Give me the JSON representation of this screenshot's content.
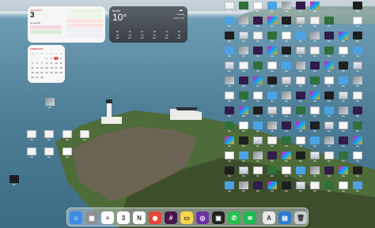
{
  "reminders": {
    "weekday": "SATURDAY",
    "day": "3",
    "left_items": [
      "no events",
      "",
      "",
      ""
    ],
    "right_items": [
      "Reminder item",
      "Reminder item",
      "Reminder item",
      "Reminder item",
      "Reminder item",
      "Reminder item"
    ]
  },
  "weather": {
    "city": "Berlin",
    "temp": "10°",
    "condition": "Cloudy",
    "hilo": "H:13° L:5°",
    "forecast": [
      {
        "t": "10",
        "d": "10°"
      },
      {
        "t": "11",
        "d": "11°"
      },
      {
        "t": "12",
        "d": "12°"
      },
      {
        "t": "13",
        "d": "12°"
      },
      {
        "t": "14",
        "d": "13°"
      },
      {
        "t": "15",
        "d": "12°"
      }
    ]
  },
  "calendar": {
    "month": "FEBRUARY",
    "weekdays": [
      "M",
      "T",
      "W",
      "T",
      "F",
      "S",
      "S"
    ],
    "days": [
      "",
      "",
      "",
      "1",
      "2",
      "3",
      "4",
      "5",
      "6",
      "7",
      "8",
      "9",
      "10",
      "11",
      "12",
      "13",
      "14",
      "15",
      "16",
      "17",
      "18",
      "19",
      "20",
      "21",
      "22",
      "23",
      "24",
      "25",
      "26",
      "27",
      "28",
      "",
      ""
    ],
    "today": "3"
  },
  "desktop": {
    "icon_label": "File"
  },
  "dock": {
    "apps": [
      {
        "name": "finder",
        "glyph": "☺",
        "color": "#3a8ee6"
      },
      {
        "name": "launchpad",
        "glyph": "▦",
        "color": "#8e8e93"
      },
      {
        "name": "reminders",
        "glyph": "≡",
        "color": "#ffffff"
      },
      {
        "name": "calendar",
        "glyph": "3",
        "color": "#ffffff"
      },
      {
        "name": "notion",
        "glyph": "N",
        "color": "#ffffff"
      },
      {
        "name": "chrome",
        "glyph": "◉",
        "color": "#e84335"
      },
      {
        "name": "slack",
        "glyph": "#",
        "color": "#4a154b"
      },
      {
        "name": "notes",
        "glyph": "▭",
        "color": "#f8d54a"
      },
      {
        "name": "tor",
        "glyph": "◎",
        "color": "#6b2fa3"
      },
      {
        "name": "screenshots",
        "glyph": "▣",
        "color": "#222222"
      },
      {
        "name": "whatsapp",
        "glyph": "✆",
        "color": "#27c04f"
      },
      {
        "name": "spotify",
        "glyph": "≋",
        "color": "#1db954"
      },
      {
        "name": "acrobat",
        "glyph": "A",
        "color": "#e8e8e8"
      },
      {
        "name": "preview",
        "glyph": "▤",
        "color": "#2b7bd6"
      },
      {
        "name": "trash",
        "glyph": "🗑",
        "color": "#c7ccd1"
      }
    ]
  }
}
